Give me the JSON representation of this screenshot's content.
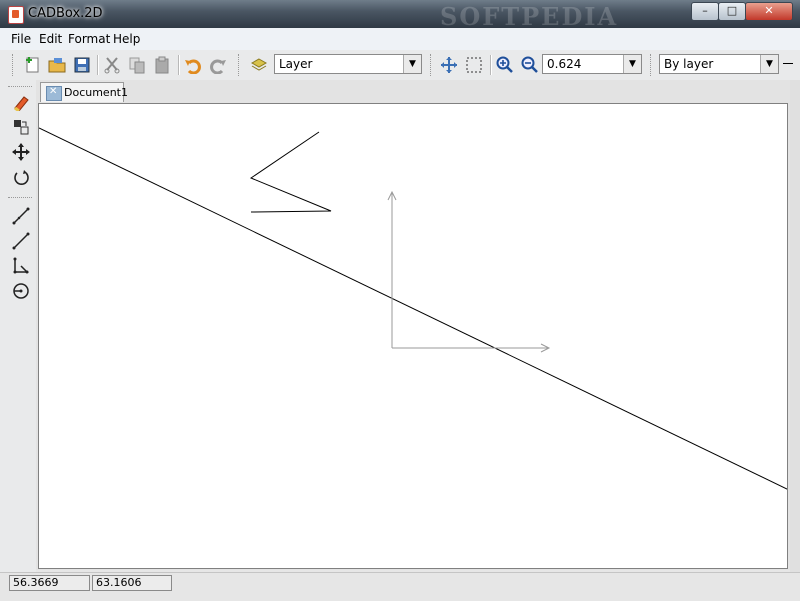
{
  "window": {
    "title": "CADBox.2D",
    "title_bg_text": "SOFTPEDIA",
    "buttons": {
      "minimize": "–",
      "maximize": "□",
      "close": "✕"
    }
  },
  "menu": {
    "items": [
      "File",
      "Edit",
      "Format",
      "Help"
    ]
  },
  "toolbar": {
    "layer_value": "Layer",
    "zoom_value": "0.624",
    "linetype_value": "By layer"
  },
  "document": {
    "tab_label": "Document1"
  },
  "status": {
    "x": "56.3669",
    "y": "63.1606"
  },
  "colors": {
    "accent": "#e35b2a",
    "canvas": "#ffffff"
  }
}
